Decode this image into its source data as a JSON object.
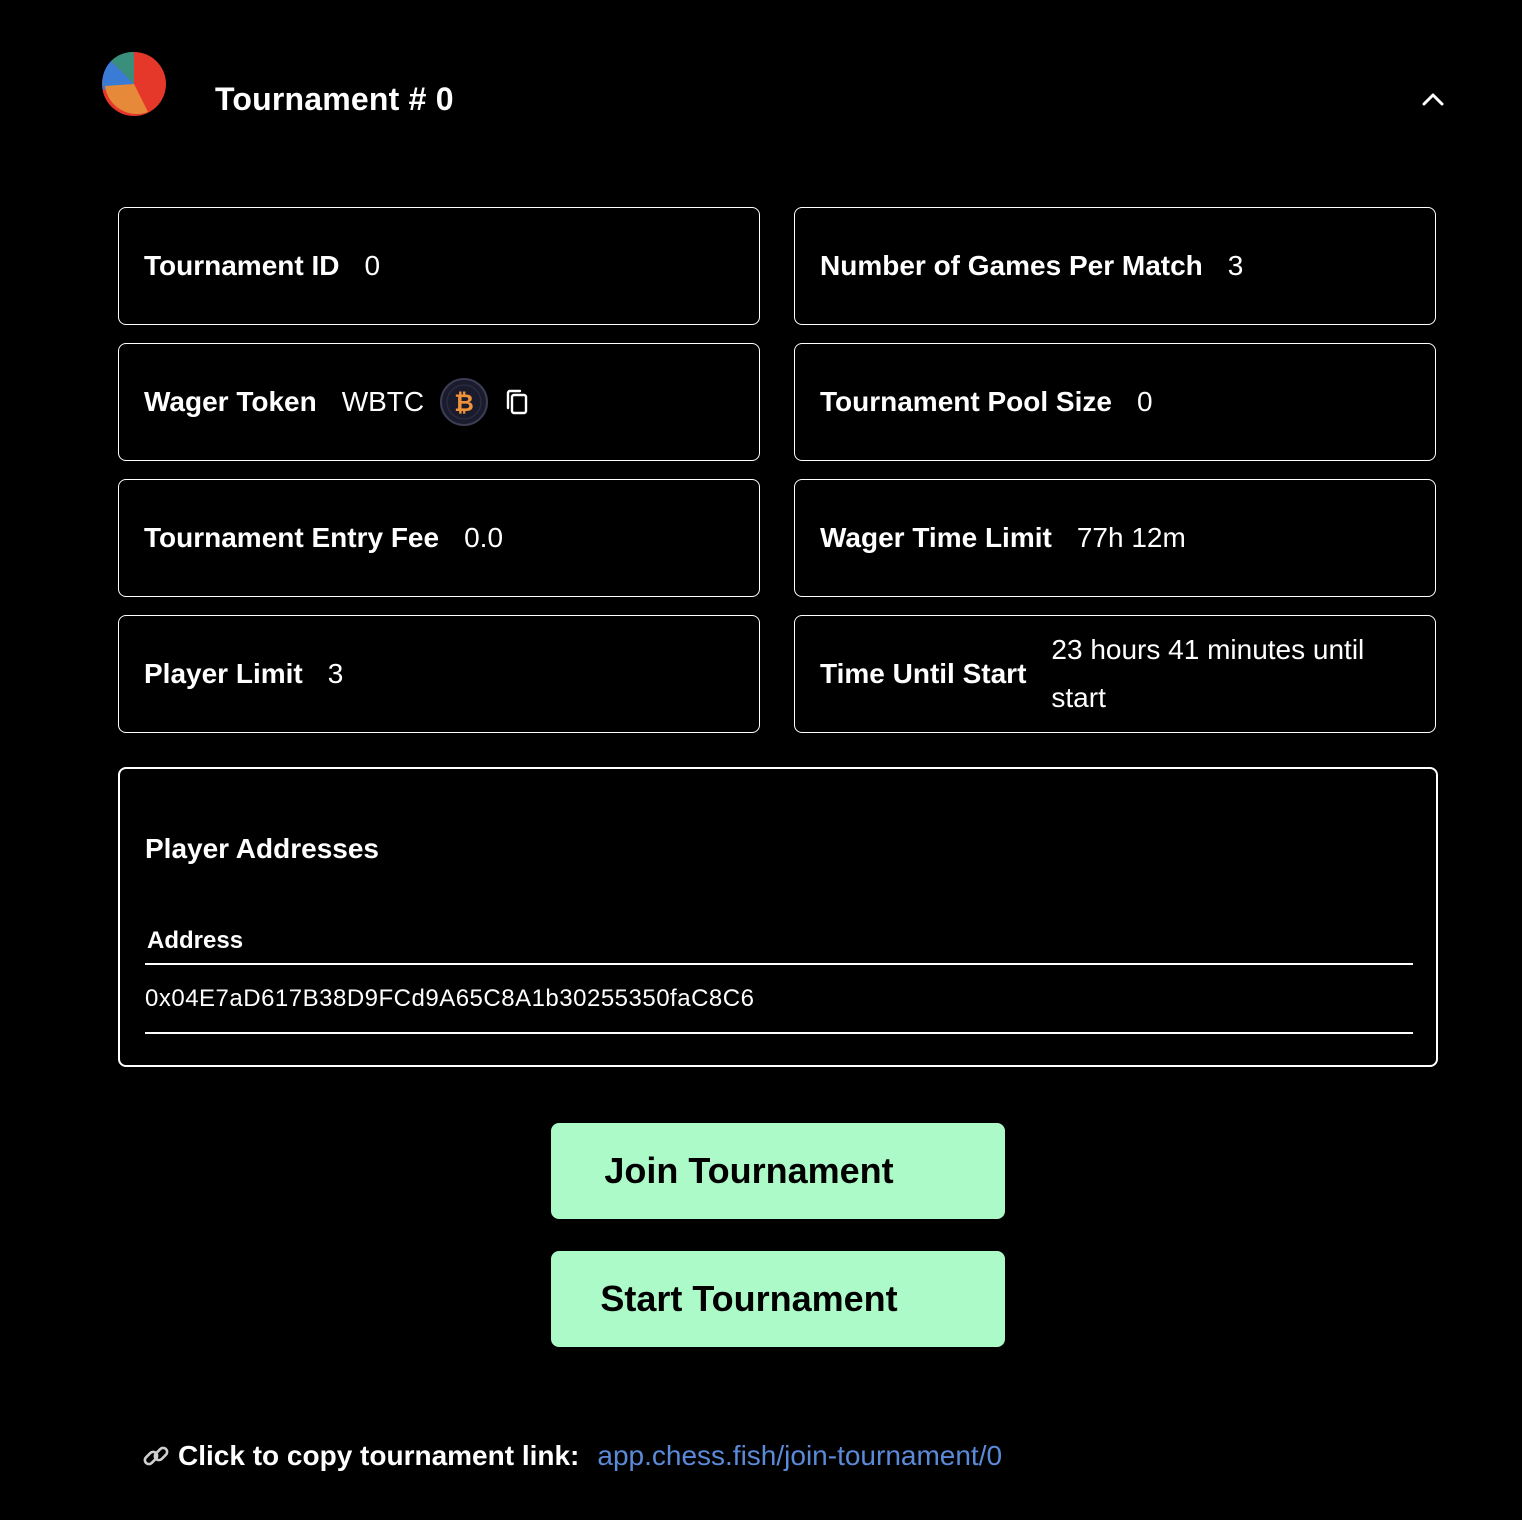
{
  "header": {
    "title": "Tournament # 0",
    "collapse_icon": "chevron-up-icon"
  },
  "details": {
    "tournament_id": {
      "label": "Tournament ID",
      "value": "0"
    },
    "games_per_match": {
      "label": "Number of Games Per Match",
      "value": "3"
    },
    "wager_token": {
      "label": "Wager Token",
      "value": "WBTC",
      "token_icon": "bitcoin-icon",
      "copy_icon": "copy-icon"
    },
    "pool_size": {
      "label": "Tournament Pool Size",
      "value": "0"
    },
    "entry_fee": {
      "label": "Tournament Entry Fee",
      "value": "0.0"
    },
    "wager_time_limit": {
      "label": "Wager Time Limit",
      "value": "77h 12m"
    },
    "player_limit": {
      "label": "Player Limit",
      "value": "3"
    },
    "time_until_start": {
      "label": "Time Until Start",
      "value": "23 hours 41 minutes until start"
    }
  },
  "players": {
    "title": "Player Addresses",
    "column_header": "Address",
    "rows": [
      "0x04E7aD617B38D9FCd9A65C8A1b30255350faC8C6"
    ]
  },
  "actions": {
    "join_label": "Join Tournament",
    "start_label": "Start Tournament"
  },
  "footer": {
    "copy_label": "Click to copy tournament link:",
    "link": "app.chess.fish/join-tournament/0",
    "link_icon": "link-icon"
  },
  "colors": {
    "background": "#000000",
    "button": "#adfac9",
    "link": "#5b8ad8"
  }
}
